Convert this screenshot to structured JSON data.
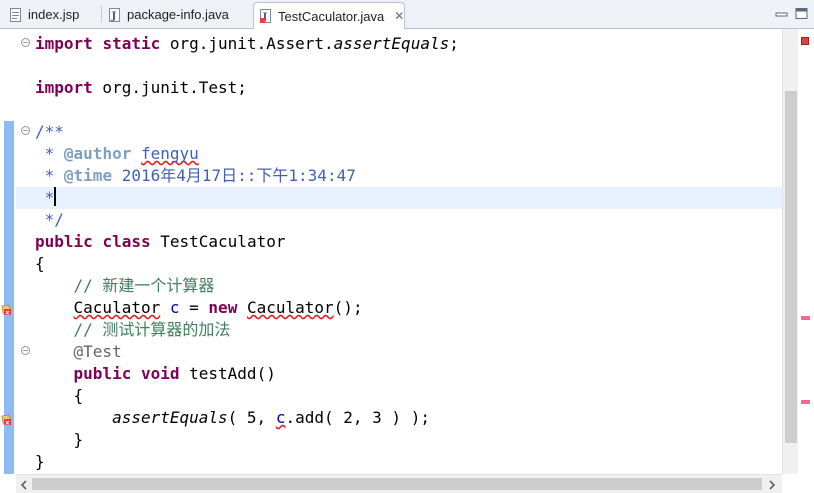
{
  "tabs": [
    {
      "label": "index.jsp",
      "icon": "jsp-file-icon"
    },
    {
      "label": "package-info.java",
      "icon": "java-file-icon"
    },
    {
      "label": "TestCaculator.java",
      "icon": "java-class-file-icon",
      "active": true,
      "close": "✕"
    }
  ],
  "window_controls": {
    "minimize_icon": "minimize-icon",
    "maximize_icon": "maximize-icon"
  },
  "code": {
    "l1": {
      "kw1": "import",
      "kw2": "static",
      "t1": " org.junit.Assert.",
      "it": "assertEquals",
      "t2": ";"
    },
    "l3": {
      "kw": "import",
      "t": " org.junit.Test;"
    },
    "l5": {
      "t": "/**"
    },
    "l6": {
      "t1": " * ",
      "tag": "@author",
      "t2": " ",
      "name": "fengyu"
    },
    "l7": {
      "t1": " * ",
      "tag": "@time",
      "t2": " 2016年4月17日::下午1:34:47"
    },
    "l8": {
      "t": " *"
    },
    "l9": {
      "t": " */"
    },
    "l10": {
      "kw1": "public",
      "kw2": "class",
      "t": " TestCaculator"
    },
    "l11": {
      "t": "{"
    },
    "l12": {
      "indent": "    ",
      "t": "// 新建一个计算器"
    },
    "l13": {
      "indent": "    ",
      "type": "Caculator",
      "t1": " ",
      "var": "c",
      "t2": " = ",
      "kw": "new",
      "t3": " ",
      "ctor": "Caculator",
      "t4": "();"
    },
    "l14": {
      "indent": "    ",
      "t": "// 测试计算器的加法"
    },
    "l15": {
      "indent": "    ",
      "t": "@Test"
    },
    "l16": {
      "indent": "    ",
      "kw1": "public",
      "kw2": "void",
      "t": " testAdd()"
    },
    "l17": {
      "indent": "    ",
      "t": "{"
    },
    "l18": {
      "indent": "        ",
      "it": "assertEquals",
      "t1": "( 5, ",
      "var": "c",
      "t2": ".add( 2, 3 ) );"
    },
    "l19": {
      "indent": "    ",
      "t": "}"
    },
    "l20": {
      "t": "}"
    }
  },
  "colors": {
    "keyword": "#7f0055",
    "javadoc": "#3f5fbf",
    "javadoc_tag": "#7f9fbf",
    "comment": "#3f7f5f",
    "annotation": "#646464",
    "field": "#0000c0",
    "error": "#e02020",
    "current_line": "#e8f2fe"
  }
}
